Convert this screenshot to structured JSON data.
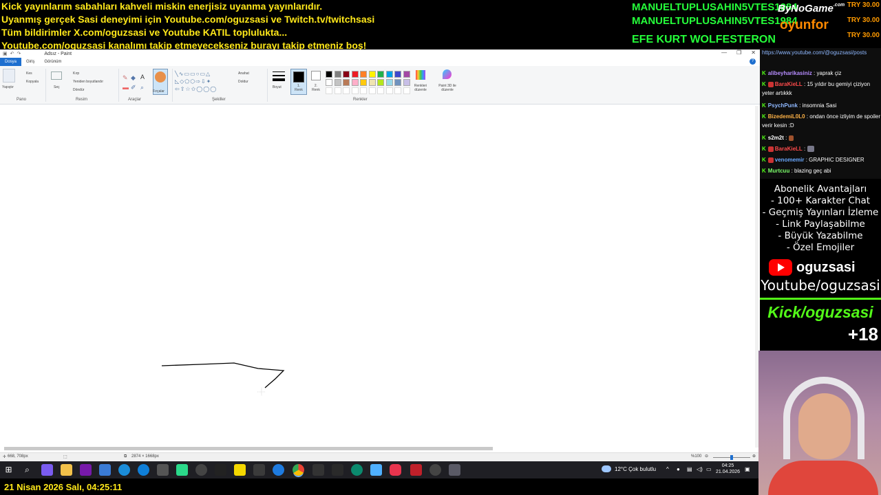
{
  "ticker": {
    "line1": "Kick yayınlarım sabahları kahveli miskin enerjisiz uyanma yayınlarıdır.",
    "line2": "Uyanmış gerçek Sasi deneyimi için Youtube.com/oguzsasi ve Twitch.tv/twitchsasi",
    "line3": "Tüm bildirimler X.com/oguzsasi ve Youtube KATIL toplulukta...",
    "line4": "Youtube.com/oguzsasi kanalımı takip etmeyecekseniz burayı takip etmeniz boş!"
  },
  "donors": {
    "d1": "MANUELTUPLUSAHIN5VTES1984",
    "d2": "MANUELTUPLUSAHIN5VTES1984",
    "d3": "EFE KURT WOLFESTERON",
    "a1": "TRY 30.00",
    "a2": "TRY 30.00",
    "a3": "TRY 30.00",
    "brand_top": "ByNoGame",
    "brand_com": ".com",
    "brand_bottom": "oyunfor"
  },
  "paint": {
    "title": "Adsız - Paint",
    "tabs": [
      "Dosya",
      "Giriş",
      "Görünüm"
    ],
    "groups": {
      "pano": "Pano",
      "resim": "Resim",
      "araclar": "Araçlar",
      "sekiller": "Şekiller",
      "renkler": "Renkler"
    },
    "buttons": {
      "yapistir": "Yapıştır",
      "kes": "Kes",
      "kopyala": "Kopyala",
      "sec": "Seç",
      "kirp": "Kırp",
      "yeniden": "Yeniden boyutlandır",
      "dondur": "Döndür",
      "fircalar": "Fırçalar",
      "anahat": "Anahat",
      "doldur": "Doldur",
      "boyut": "Boyut",
      "renk1": "1. Renk",
      "renk2": "2. Renk",
      "renk_duzenle": "Renkleri düzenle",
      "paint3d": "Paint 3D ile düzenle"
    },
    "palette": [
      "#000000",
      "#7f7f7f",
      "#880015",
      "#ed1c24",
      "#ff7f27",
      "#fff200",
      "#22b14c",
      "#00a2e8",
      "#3f48cc",
      "#a349a4",
      "#ffffff",
      "#c3c3c3",
      "#b97a57",
      "#ffaec9",
      "#ffc90e",
      "#efe4b0",
      "#b5e61d",
      "#99d9ea",
      "#7092be",
      "#c8bfe7"
    ],
    "status": {
      "cursor": "668, 708px",
      "size": "2874 × 1668px",
      "zoom": "%100"
    }
  },
  "taskbar": {
    "weather": "12°C  Çok bulutlu",
    "time": "04:25",
    "date": "21.04.2026"
  },
  "bottom_date": "21 Nisan 2026 Salı, 04:25:11",
  "chat": {
    "url": "https://www.youtube.com/@oguzsasi/posts",
    "messages": [
      {
        "user": "alibeyharikasiniz",
        "text": ": yaprak çiz",
        "color": "#b68cff"
      },
      {
        "user": "BaraKieLL",
        "text": ": 15 yıldır bu gemiyi çiziyon yeter artıkkk",
        "color": "#ff4b4b"
      },
      {
        "user": "PsychPunk",
        "text": ": insomnia Sasi",
        "color": "#8fb8ff"
      },
      {
        "user": "BizedemiL0L0",
        "text": ": ondan önce izliyim de spoiler verir kesin :D",
        "color": "#ffb347"
      },
      {
        "user": "s2m2t",
        "text": ":",
        "color": "#ffffff"
      },
      {
        "user": "BaraKieLL",
        "text": ":",
        "color": "#ff4b4b"
      },
      {
        "user": "venomemir",
        "text": ": GRAPHIC DESIGNER",
        "color": "#6aa8ff"
      },
      {
        "user": "Murtcuu",
        "text": ": blazing geç abi",
        "color": "#7cff6a"
      }
    ]
  },
  "perks": {
    "title": "Abonelik Avantajları",
    "p1": "- 100+ Karakter Chat",
    "p2": "- Geçmiş Yayınları İzleme",
    "p3": "- Link Paylaşabilme",
    "p4": "- Büyük Yazabilme",
    "p5": "- Özel Emojiler"
  },
  "socials": {
    "yt_name": "oguzsasi",
    "yt_link": "Youtube/oguzsasi",
    "kick": "Kick/oguzsasi",
    "age": "+18"
  }
}
